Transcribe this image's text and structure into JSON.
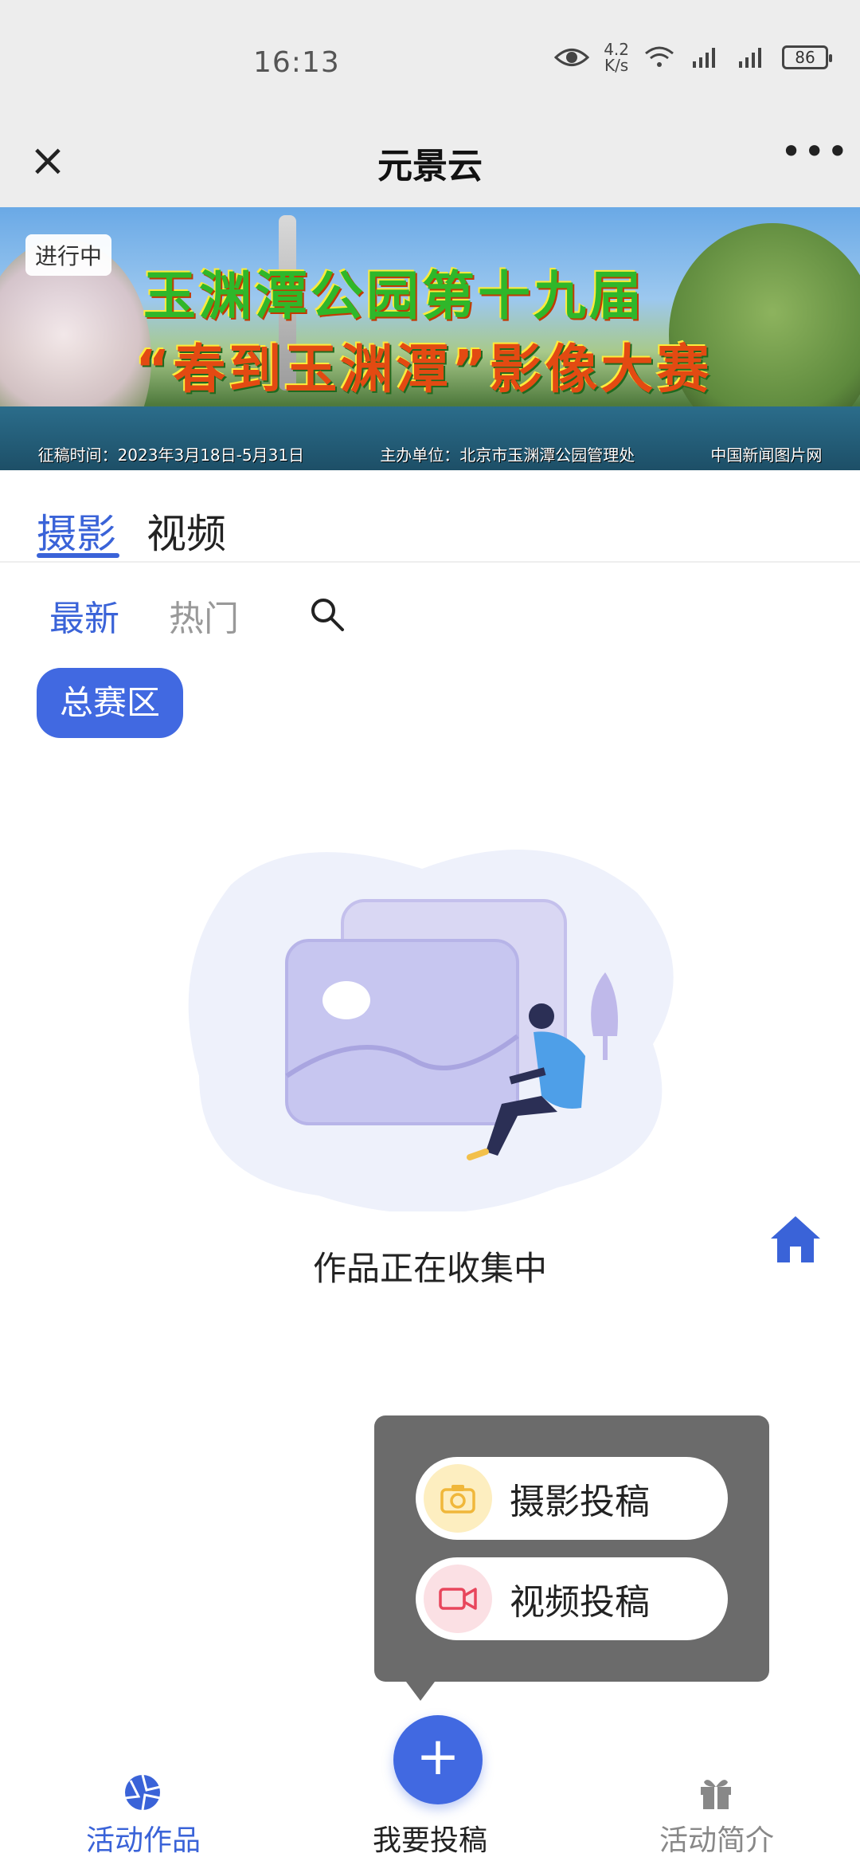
{
  "status_bar": {
    "time": "16:13",
    "net_speed_value": "4.2",
    "net_speed_unit": "K/s",
    "battery": "86"
  },
  "title_bar": {
    "title": "元景云",
    "close_icon": "close-icon",
    "more_icon": "more-icon"
  },
  "banner": {
    "status_badge": "进行中",
    "line1": "玉渊潭公园第十九届",
    "line2": "“春到玉渊潭”影像大赛",
    "submission_period": "征稿时间：2023年3月18日-5月31日",
    "organizer": "主办单位：北京市玉渊潭公园管理处",
    "partner": "中国新闻图片网"
  },
  "category_tabs": {
    "items": [
      "摄影",
      "视频"
    ],
    "active": "摄影"
  },
  "sort_tabs": {
    "items": [
      "最新",
      "热门"
    ],
    "active": "最新",
    "search_icon": "search-icon"
  },
  "zone_chip": "总赛区",
  "empty_state": {
    "text": "作品正在收集中"
  },
  "popover": {
    "photo_submit": "摄影投稿",
    "video_submit": "视频投稿"
  },
  "bottom_nav": {
    "works": "活动作品",
    "submit": "我要投稿",
    "intro": "活动简介",
    "fab_symbol": "+"
  },
  "colors": {
    "accent": "#3a63d8",
    "chip": "#4169e1",
    "popover": "#6b6b6b"
  }
}
